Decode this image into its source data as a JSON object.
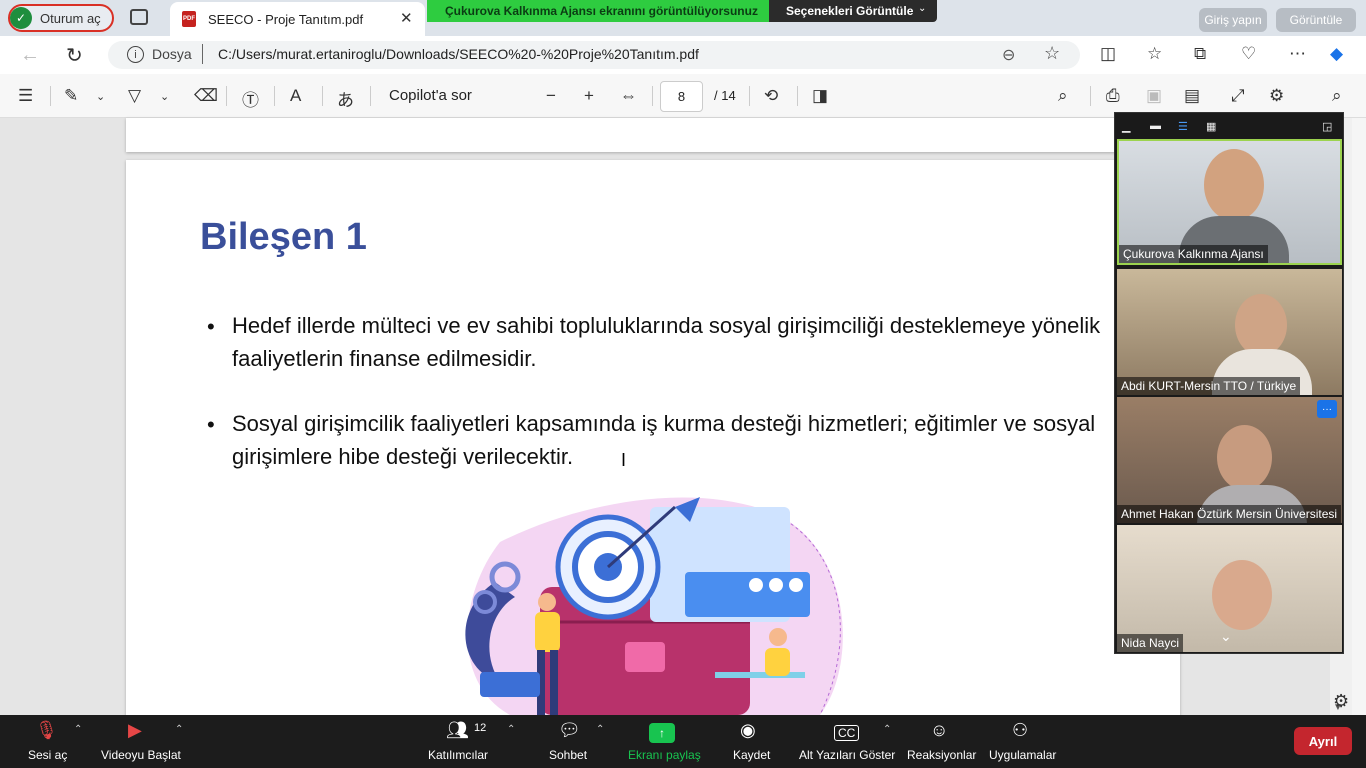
{
  "browser": {
    "tab_inactive_label": "Oturum aç",
    "tab_active_label": "SEECO - Proje Tanıtım.pdf",
    "tab_close": "✕",
    "signin_label": "Giriş yapın",
    "view_label": "Görüntüle",
    "address_label": "Dosya",
    "url": "C:/Users/murat.ertaniroglu/Downloads/SEECO%20-%20Proje%20Tanıtım.pdf"
  },
  "zoom_share": {
    "banner_text": "Çukurova Kalkınma Ajansı ekranını görüntülüyorsunuz",
    "options_label": "Seçenekleri Görüntüle"
  },
  "pdf_toolbar": {
    "copilot_label": "Copilot'a sor",
    "current_page": "8",
    "total_pages": "/ 14"
  },
  "slide": {
    "title": "Bileşen 1",
    "bullets": [
      "Hedef illerde mülteci ve ev sahibi topluluklarında sosyal girişimciliği desteklemeye yönelik faaliyetlerin finanse edilmesidir.",
      "Sosyal girişimcilik faaliyetleri kapsamında iş kurma desteği hizmetleri; eğitimler ve sosyal girişimlere hibe desteği verilecektir."
    ]
  },
  "participants": [
    {
      "name": "Çukurova Kalkınma Ajansı"
    },
    {
      "name": "Abdi KURT-Mersin TTO / Türkiye"
    },
    {
      "name": "Ahmet Hakan Öztürk Mersin Üniversitesi"
    },
    {
      "name": "Nida Nayci"
    }
  ],
  "meeting_toolbar": {
    "mute_label": "Sesi aç",
    "video_label": "Videoyu Başlat",
    "participants_label": "Katılımcılar",
    "participants_count": "12",
    "chat_label": "Sohbet",
    "share_label": "Ekranı paylaş",
    "record_label": "Kaydet",
    "captions_label": "Alt Yazıları Göster",
    "reactions_label": "Reaksiyonlar",
    "apps_label": "Uygulamalar",
    "leave_label": "Ayrıl"
  },
  "colors": {
    "title_blue": "#3a4f9a",
    "share_green": "#2ecc40",
    "leave_red": "#c4262e",
    "active_speaker_border": "#9cd34f"
  }
}
